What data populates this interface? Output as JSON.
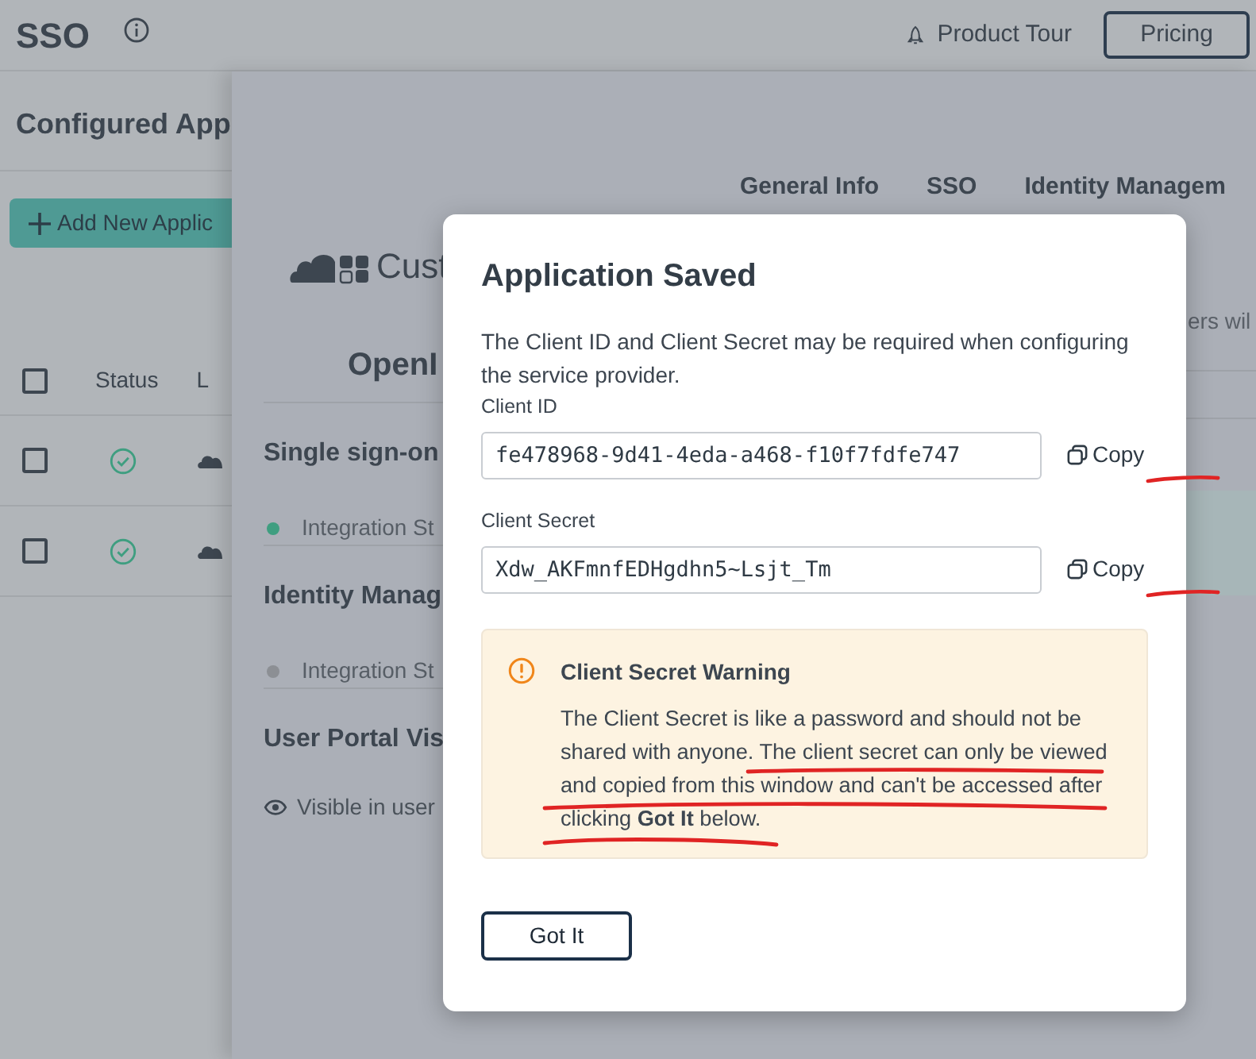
{
  "header": {
    "title": "SSO",
    "tour_label": "Product Tour",
    "pricing_label": "Pricing"
  },
  "app_list": {
    "title": "Configured App",
    "add_button": "Add New Applic",
    "select_all_checked": false,
    "columns": [
      "Status",
      "L"
    ],
    "rows": [
      {
        "checked": false,
        "active": true
      },
      {
        "checked": false,
        "active": true
      }
    ]
  },
  "detail_panel": {
    "logo_text": "Cust",
    "tabs": [
      {
        "label": "General Info",
        "selected": false
      },
      {
        "label": "SSO",
        "selected": false
      },
      {
        "label": "Identity Managem",
        "selected": false
      }
    ],
    "heading": "OpenI",
    "note": "ers wil",
    "sections": [
      {
        "title": "Single sign-on",
        "status": "Integration St",
        "color": "#3f9e80"
      },
      {
        "title": "Identity Manag",
        "status": "Integration St",
        "color": "#8c8f94"
      }
    ],
    "visibility_title": "User Portal Vis",
    "visibility": "Visible in user"
  },
  "modal": {
    "title": "Application Saved",
    "description": "The Client ID and Client Secret may be required when configuring the service provider.",
    "fields": [
      {
        "label": "Client ID",
        "value": "fe478968-9d41-4eda-a468-f10f7fdfe747",
        "copy_label": "Copy",
        "marked": true
      },
      {
        "label": "Client Secret",
        "value": "Xdw_AKFmnfEDHgdhn5~Lsjt_Tm",
        "copy_label": "Copy",
        "marked": true
      }
    ],
    "warning": {
      "title": "Client Secret Warning",
      "body": "The Client Secret is like a password and should not be shared with anyone. The client secret can only be viewed and copied from this window and can't be accessed after clicking **Got It** below.",
      "marked": true
    },
    "button": "Got It"
  }
}
